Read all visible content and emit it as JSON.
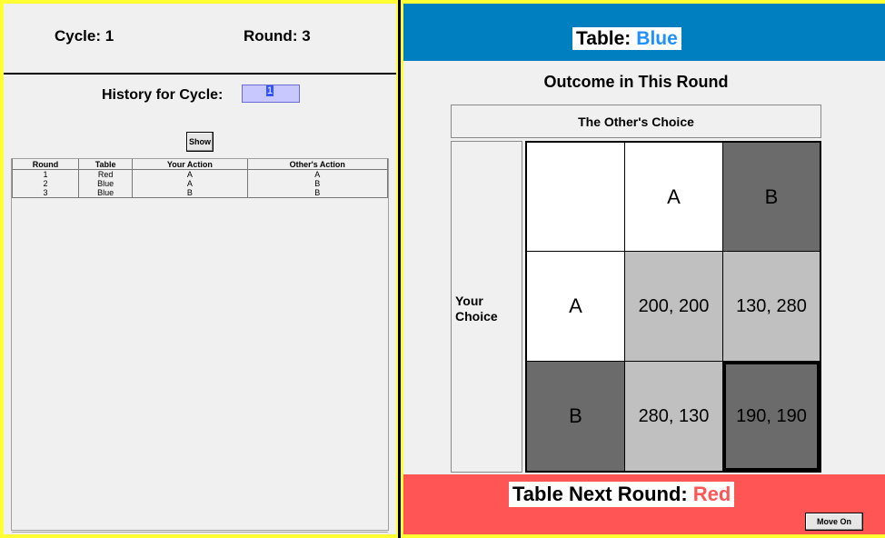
{
  "header": {
    "cycle_text": "Cycle:  1",
    "round_text": "Round:  3"
  },
  "history": {
    "label": "History for Cycle:",
    "input_value": "1",
    "show_button": "Show",
    "columns": [
      "Round",
      "Table",
      "Your Action",
      "Other's Action"
    ],
    "rows": [
      [
        "1",
        "Red",
        "A",
        "A"
      ],
      [
        "2",
        "Blue",
        "A",
        "B"
      ],
      [
        "3",
        "Blue",
        "B",
        "B"
      ]
    ]
  },
  "current_table": {
    "label": "Table:",
    "name": "Blue",
    "color": "#007fc0"
  },
  "outcome": {
    "title": "Outcome in This Round",
    "other_choice_label": "The Other's Choice",
    "your_choice_label_line1": "Your",
    "your_choice_label_line2": "Choice",
    "col_headers": [
      "A",
      "B"
    ],
    "row_headers": [
      "A",
      "B"
    ],
    "payoffs": [
      [
        "200, 200",
        "130, 280"
      ],
      [
        "280, 130",
        "190, 190"
      ]
    ],
    "highlighted_cell": "B,B"
  },
  "next_table": {
    "label": "Table Next Round:",
    "name": "Red",
    "color": "#ff5555"
  },
  "move_on_button": "Move On"
}
